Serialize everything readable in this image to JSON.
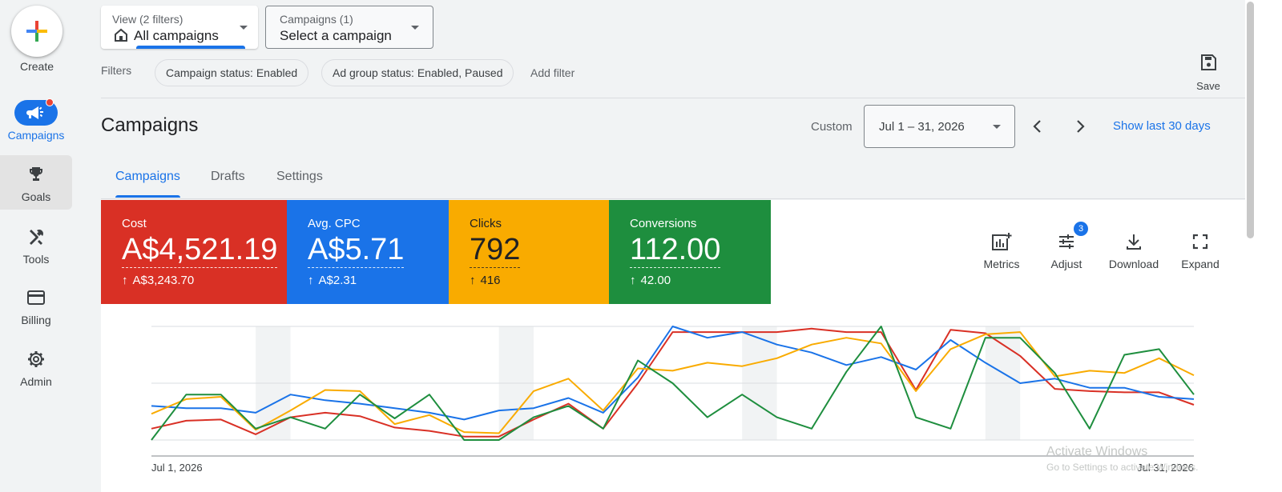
{
  "rail": {
    "create_label": "Create",
    "items": [
      {
        "label": "Campaigns",
        "icon": "megaphone-icon"
      },
      {
        "label": "Goals",
        "icon": "trophy-icon"
      },
      {
        "label": "Tools",
        "icon": "tools-icon"
      },
      {
        "label": "Billing",
        "icon": "credit-card-icon"
      },
      {
        "label": "Admin",
        "icon": "gear-icon"
      }
    ]
  },
  "top": {
    "view_small": "View (2 filters)",
    "view_big": "All campaigns",
    "campaign_small": "Campaigns (1)",
    "campaign_big": "Select a campaign"
  },
  "filters": {
    "label": "Filters",
    "chips": [
      "Campaign status: Enabled",
      "Ad group status: Enabled, Paused"
    ],
    "add": "Add filter",
    "save": "Save"
  },
  "header": {
    "title": "Campaigns",
    "custom": "Custom",
    "date_range": "Jul 1 – 31, 2026",
    "show_last": "Show last 30 days"
  },
  "tabs": [
    "Campaigns",
    "Drafts",
    "Settings"
  ],
  "cards": [
    {
      "title": "Cost",
      "value": "A$4,521.19",
      "delta": "A$3,243.70",
      "color": "#d93025"
    },
    {
      "title": "Avg. CPC",
      "value": "A$5.71",
      "delta": "A$2.31",
      "color": "#1a73e8"
    },
    {
      "title": "Clicks",
      "value": "792",
      "delta": "416",
      "color": "#f9ab00"
    },
    {
      "title": "Conversions",
      "value": "112.00",
      "delta": "42.00",
      "color": "#1e8e3e"
    }
  ],
  "tools": {
    "metrics": "Metrics",
    "adjust": "Adjust",
    "adjust_badge": "3",
    "download": "Download",
    "expand": "Expand"
  },
  "chart_data": {
    "type": "line",
    "x": [
      "Jul 1, 2026",
      "Jul 2, 2026",
      "Jul 3, 2026",
      "Jul 4, 2026",
      "Jul 5, 2026",
      "Jul 6, 2026",
      "Jul 7, 2026",
      "Jul 8, 2026",
      "Jul 9, 2026",
      "Jul 10, 2026",
      "Jul 11, 2026",
      "Jul 12, 2026",
      "Jul 13, 2026",
      "Jul 14, 2026",
      "Jul 15, 2026",
      "Jul 16, 2026",
      "Jul 17, 2026",
      "Jul 18, 2026",
      "Jul 19, 2026",
      "Jul 20, 2026",
      "Jul 21, 2026",
      "Jul 22, 2026",
      "Jul 23, 2026",
      "Jul 24, 2026",
      "Jul 25, 2026",
      "Jul 26, 2026",
      "Jul 27, 2026",
      "Jul 28, 2026",
      "Jul 29, 2026",
      "Jul 30, 2026",
      "Jul 31, 2026"
    ],
    "x_tick_labels": [
      "Jul 1, 2026",
      "Jul 31, 2026"
    ],
    "weekend_bands": [
      [
        3,
        4
      ],
      [
        10,
        11
      ],
      [
        17,
        18
      ],
      [
        24,
        25
      ]
    ],
    "ylim": [
      0,
      100
    ],
    "grid": true,
    "series": [
      {
        "values": [
          10,
          17,
          18,
          5,
          20,
          24,
          21,
          11,
          8,
          3,
          3,
          18,
          32,
          10,
          50,
          95,
          95,
          95,
          95,
          98,
          95,
          95,
          44,
          97,
          94,
          74,
          45,
          43,
          42,
          42,
          31
        ],
        "color": "#d93025"
      },
      {
        "values": [
          30,
          28,
          28,
          24,
          40,
          35,
          32,
          28,
          24,
          18,
          26,
          28,
          37,
          24,
          55,
          100,
          90,
          95,
          84,
          77,
          66,
          73,
          62,
          88,
          68,
          50,
          54,
          46,
          46,
          38,
          36
        ],
        "color": "#1a73e8"
      },
      {
        "values": [
          23,
          36,
          38,
          9,
          26,
          44,
          43,
          14,
          22,
          7,
          6,
          43,
          54,
          26,
          63,
          61,
          68,
          65,
          72,
          84,
          90,
          85,
          43,
          80,
          93,
          95,
          56,
          61,
          59,
          72,
          57
        ],
        "color": "#f9ab00"
      },
      {
        "values": [
          0,
          40,
          40,
          10,
          20,
          10,
          40,
          19,
          40,
          0,
          0,
          20,
          30,
          10,
          70,
          50,
          20,
          40,
          20,
          10,
          60,
          100,
          20,
          10,
          90,
          90,
          59,
          10,
          75,
          80,
          40
        ],
        "color": "#1e8e3e"
      }
    ]
  },
  "watermark": {
    "line1": "Activate Windows",
    "line2": "Go to Settings to activate Windows."
  }
}
